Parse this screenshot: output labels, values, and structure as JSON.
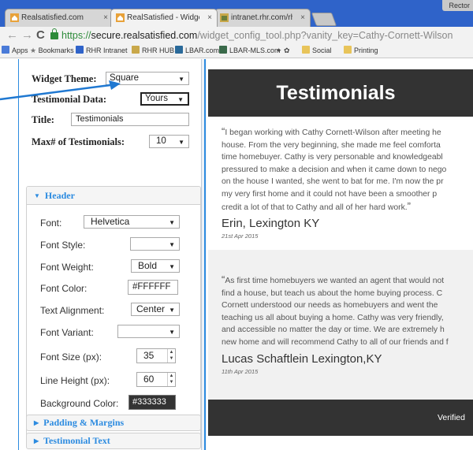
{
  "browser": {
    "user_label": "Rector",
    "tabs": [
      {
        "title": "Realsatisfied.com"
      },
      {
        "title": "RealSatisfied - Widget Co"
      },
      {
        "title": "intranet.rhr.com/rhnr/intr"
      }
    ],
    "url": {
      "scheme": "https://",
      "host": "secure.realsatisfied.com",
      "path": "/widget_config_tool.php?vanity_key=Cathy-Cornett-Wilson"
    },
    "bookmarks": [
      "Apps",
      "Bookmarks",
      "RHR Intranet",
      "RHR HUB",
      "LBAR.com",
      "LBAR-MLS.com",
      "Social",
      "Printing"
    ]
  },
  "config": {
    "widget_theme": {
      "label": "Widget Theme:",
      "value": "Square"
    },
    "testimonial_data": {
      "label": "Testimonial Data:",
      "value": "Yours"
    },
    "title": {
      "label": "Title:",
      "value": "Testimonials"
    },
    "max_testimonials": {
      "label": "Max# of Testimonials:",
      "value": "10"
    },
    "header_section": {
      "label": "Header",
      "font": {
        "label": "Font:",
        "value": "Helvetica"
      },
      "font_style": {
        "label": "Font Style:",
        "value": ""
      },
      "font_weight": {
        "label": "Font Weight:",
        "value": "Bold"
      },
      "font_color": {
        "label": "Font Color:",
        "value": "#FFFFFF"
      },
      "text_alignment": {
        "label": "Text Alignment:",
        "value": "Center"
      },
      "font_variant": {
        "label": "Font Variant:",
        "value": ""
      },
      "font_size": {
        "label": "Font Size (px):",
        "value": "35"
      },
      "line_height": {
        "label": "Line Height (px):",
        "value": "60"
      },
      "background_color": {
        "label": "Background Color:",
        "value": "#333333"
      }
    },
    "padding_section": "Padding & Margins",
    "testimonial_text_section": "Testimonial Text"
  },
  "preview": {
    "title": "Testimonials",
    "testimonials": [
      {
        "lines": [
          "I began working with Cathy Cornett-Wilson after meeting he",
          "house. From the very beginning, she made me feel comforta",
          "time homebuyer. Cathy is very personable and knowledgeabl",
          "pressured to make a decision and when it came down to nego",
          "on the house I wanted, she went to bat for me. I'm now the pr",
          "my very first home and it could not have been a smoother p",
          "credit a lot of that to Cathy and all of her hard work."
        ],
        "author": "Erin, Lexington KY",
        "date": "21st Apr 2015"
      },
      {
        "lines": [
          "As first time homebuyers we wanted an agent that would not",
          "find a house, but teach us about the home buying process. C",
          "Cornett understood our needs as homebuyers and went the",
          "teaching us all about buying a home. Cathy was very friendly,",
          "and accessible no matter the day or time. We are extremely h",
          "new home and will recommend Cathy to all of our friends and f"
        ],
        "author": "Lucas Schaftlein Lexington,KY",
        "date": "11th Apr 2015"
      }
    ],
    "footer": "Verified"
  },
  "colors": {
    "accent": "#2c8be0",
    "header_bg": "#333333",
    "chrome": "#2f63c9"
  }
}
